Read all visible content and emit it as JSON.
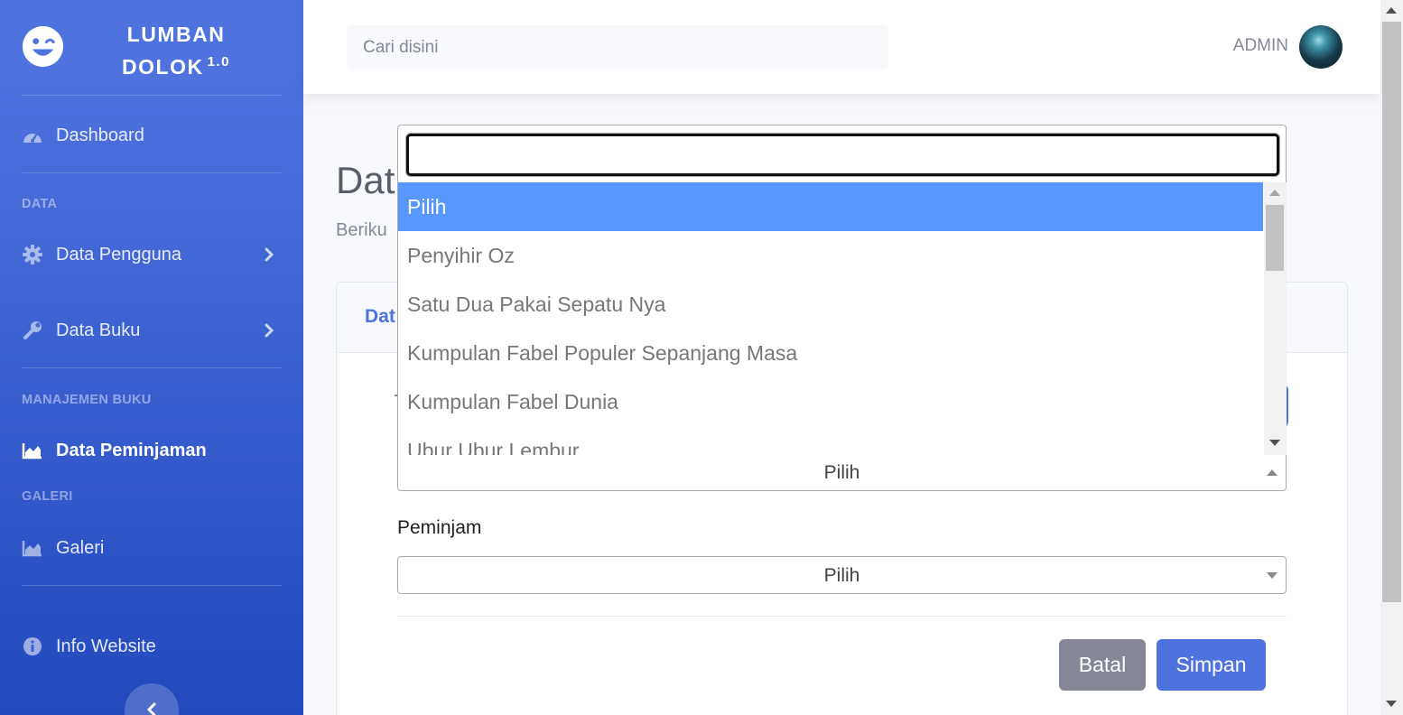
{
  "sidebar": {
    "brand": {
      "line1": "LUMBAN",
      "line2": "DOLOK",
      "version": "1.0",
      "logo_icon": "laugh-wink-icon"
    },
    "dashboard": {
      "label": "Dashboard",
      "icon": "tachometer-icon"
    },
    "heading_data": "DATA",
    "data_pengguna": {
      "label": "Data Pengguna",
      "icon": "cog-icon"
    },
    "data_buku": {
      "label": "Data Buku",
      "icon": "wrench-icon"
    },
    "heading_manajemen": "MANAJEMEN BUKU",
    "data_peminjaman": {
      "label": "Data Peminjaman",
      "icon": "area-chart-icon"
    },
    "heading_galeri": "GALERI",
    "galeri": {
      "label": "Galeri",
      "icon": "area-chart-icon"
    },
    "info_website": {
      "label": "Info Website",
      "icon": "info-circle-icon"
    },
    "toggle_icon": "chevron-left-icon"
  },
  "topbar": {
    "search_placeholder": "Cari disini",
    "user_name": "ADMIN"
  },
  "page": {
    "title": "Dat",
    "description": "Beriku",
    "card_title": "Dat"
  },
  "form": {
    "book_select": {
      "selected": "Pilih"
    },
    "borrower_label": "Peminjam",
    "borrower_select": {
      "selected": "Pilih"
    },
    "cancel_label": "Batal",
    "save_label": "Simpan"
  },
  "dropdown": {
    "search_value": "",
    "options": [
      "Pilih",
      "Penyihir Oz",
      "Satu Dua Pakai Sepatu Nya",
      "Kumpulan Fabel Populer Sepanjang Masa",
      "Kumpulan Fabel Dunia",
      "Ubur Ubur Lembur"
    ],
    "highlighted_index": 0
  },
  "colors": {
    "primary": "#4e73df",
    "secondary": "#858796",
    "highlight": "#5897fb"
  }
}
